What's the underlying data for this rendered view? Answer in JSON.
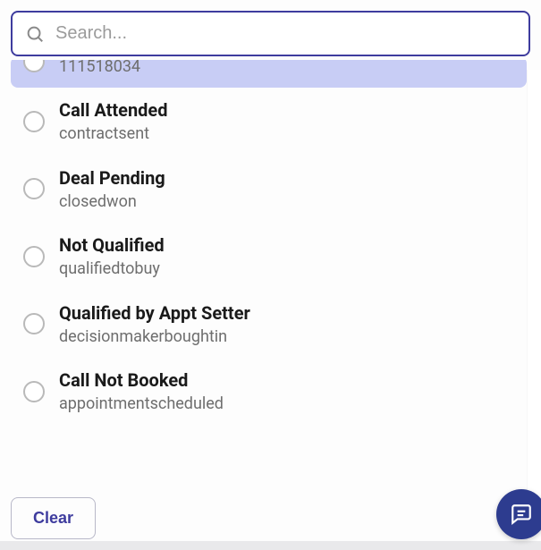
{
  "search": {
    "placeholder": "Search...",
    "value": ""
  },
  "options": [
    {
      "label": "",
      "sub": "111518034",
      "partial": true
    },
    {
      "label": "Call Attended",
      "sub": "contractsent"
    },
    {
      "label": "Deal Pending",
      "sub": "closedwon"
    },
    {
      "label": "Not Qualified",
      "sub": "qualifiedtobuy"
    },
    {
      "label": "Qualified by Appt Setter",
      "sub": "decisionmakerboughtin"
    },
    {
      "label": "Call Not Booked",
      "sub": "appointmentscheduled"
    }
  ],
  "footer": {
    "clear_label": "Clear"
  }
}
